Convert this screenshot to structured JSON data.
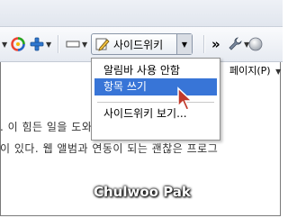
{
  "toolbar": {
    "sidewiki_label": "사이드위키",
    "more_glyph": "»"
  },
  "dropdown_menu": {
    "items": [
      {
        "label": "알림바 사용 안함"
      },
      {
        "label": "항목 쓰기"
      },
      {
        "label": "사이드위키 보기..."
      }
    ]
  },
  "page_menu_label": "페이지(P)",
  "content": {
    "line1": ". 이 힘든 일을 도와주는 소프트웨어로 구글",
    "line2": "이 있다. 웹 앨범과 연동이 되는 괜찮은 프로그"
  },
  "watermark": "Chulwoo Pak",
  "colors": {
    "highlight": "#3875d7",
    "toolbar_bg": "#eef1f6"
  },
  "icons": [
    "refresh-swirl-icon",
    "add-plus-icon",
    "page-icon",
    "sidewiki-pencil-icon",
    "wrench-icon",
    "circle-icon"
  ]
}
